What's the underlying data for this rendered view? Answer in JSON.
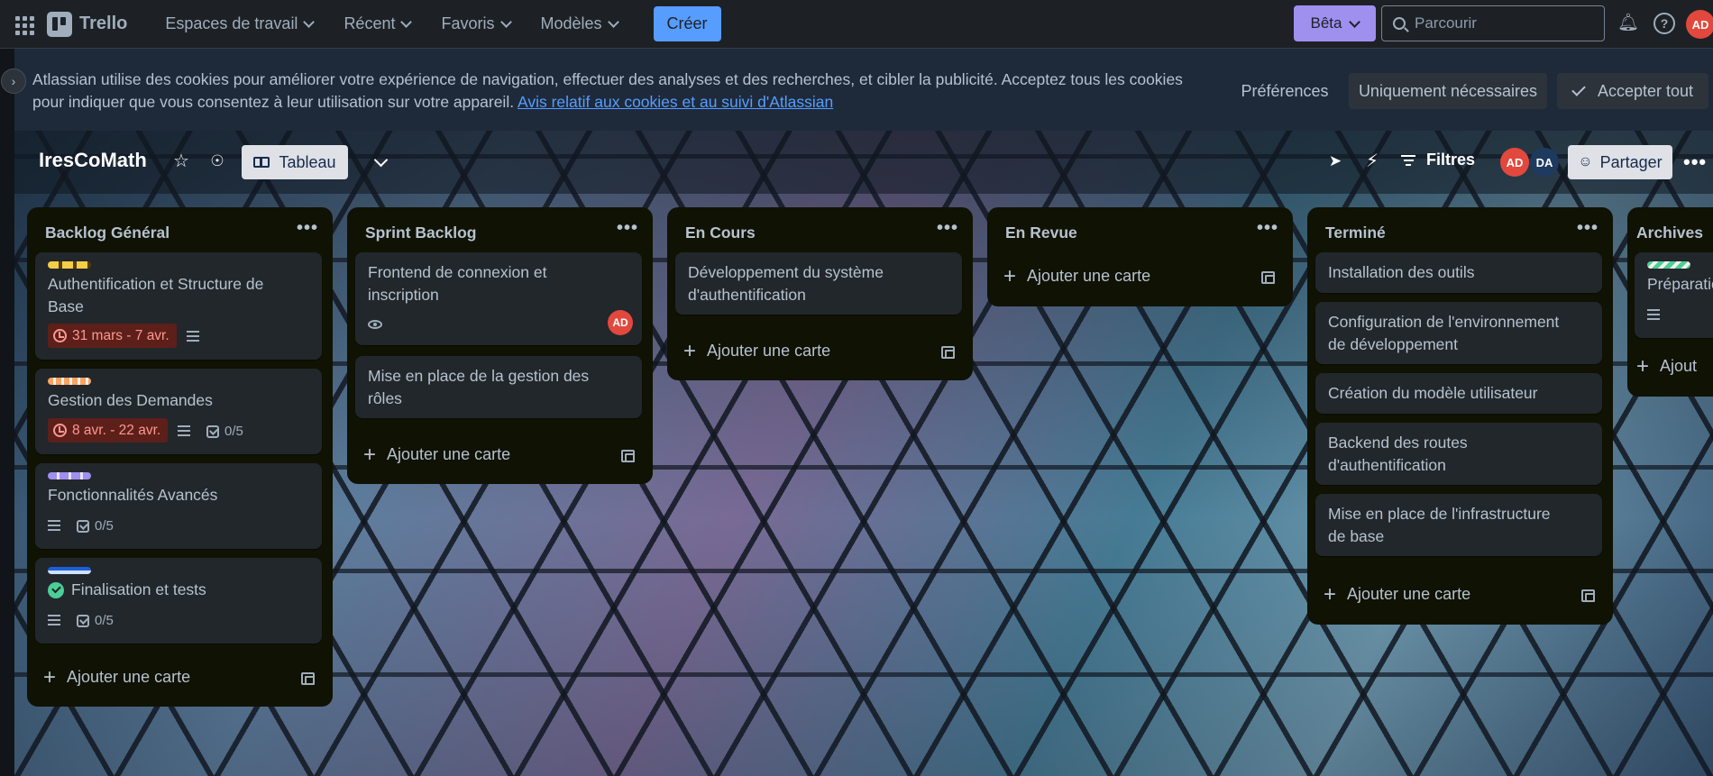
{
  "topnav": {
    "app_name": "Trello",
    "menu": [
      "Espaces de travail",
      "Récent",
      "Favoris",
      "Modèles"
    ],
    "create_label": "Créer",
    "beta_label": "Bêta",
    "search_placeholder": "Parcourir",
    "user_initials": "AD"
  },
  "cookie_banner": {
    "text_line1": "Atlassian utilise des cookies pour améliorer votre expérience de navigation, effectuer des analyses et des recherches, et cibler la publicité. Acceptez tous les cookies",
    "text_line2": "pour indiquer que vous consentez à leur utilisation sur votre appareil.",
    "link": "Avis relatif aux cookies et au suivi d'Atlassian",
    "btn_preferences": "Préférences",
    "btn_necessary": "Uniquement nécessaires",
    "btn_accept_all": "Accepter tout"
  },
  "board": {
    "title": "IresCoMath",
    "view_label": "Tableau",
    "filters_label": "Filtres",
    "members": [
      "AD",
      "DA"
    ],
    "share_label": "Partager",
    "add_card_label": "Ajouter une carte",
    "lists": [
      {
        "title": "Backlog Général",
        "cards": [
          {
            "title_l1": "Authentification et Structure de",
            "title_l2": "Base",
            "date": "31 mars - 7 avr."
          },
          {
            "title_l1": "Gestion des Demandes",
            "date": "8 avr. - 22 avr.",
            "checklist": "0/5"
          },
          {
            "title_l1": "Fonctionnalités Avancés",
            "checklist": "0/5"
          },
          {
            "title_l1": "Finalisation et tests",
            "checklist": "0/5"
          }
        ]
      },
      {
        "title": "Sprint Backlog",
        "cards": [
          {
            "title_l1": "Frontend de connexion et",
            "title_l2": "inscription",
            "member": "AD"
          },
          {
            "title_l1": "Mise en place de la gestion des",
            "title_l2": "rôles"
          }
        ]
      },
      {
        "title": "En Cours",
        "cards": [
          {
            "title_l1": "Développement du système",
            "title_l2": "d'authentification"
          }
        ]
      },
      {
        "title": "En Revue",
        "cards": []
      },
      {
        "title": "Terminé",
        "cards": [
          {
            "title_l1": "Installation des outils"
          },
          {
            "title_l1": "Configuration de l'environnement",
            "title_l2": "de développement"
          },
          {
            "title_l1": "Création du modèle utilisateur"
          },
          {
            "title_l1": "Backend des routes",
            "title_l2": "d'authentification"
          },
          {
            "title_l1": "Mise en place de l'infrastructure",
            "title_l2": "de base"
          }
        ]
      },
      {
        "title": "Archives",
        "cards": [
          {
            "title_l1": "Préparation"
          }
        ],
        "add_card_partial": "Ajout"
      }
    ]
  },
  "colors": {
    "accent": "#579dff",
    "beta": "#9f8fef",
    "avatar_red": "#e2483d",
    "list_bg": "#101204",
    "card_bg": "#22272b",
    "date_overdue_bg": "#5d1f1a",
    "label_yellow": "#f5cd47",
    "label_orange": "#fea362",
    "label_purple": "#9f8fef",
    "label_blue": "#579dff",
    "label_green": "#4bce97"
  }
}
